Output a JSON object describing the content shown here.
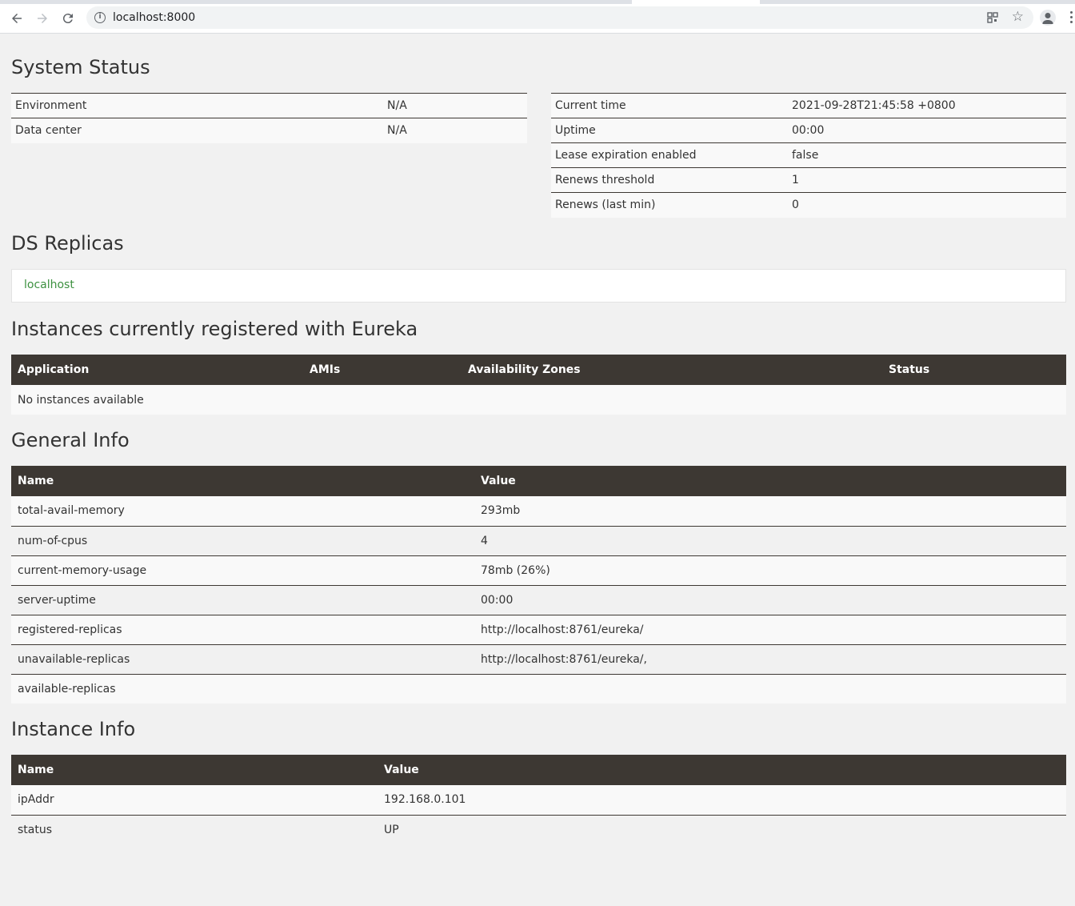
{
  "browser": {
    "url": "localhost:8000"
  },
  "system_status": {
    "title": "System Status",
    "left": [
      {
        "name": "Environment",
        "value": "N/A"
      },
      {
        "name": "Data center",
        "value": "N/A"
      }
    ],
    "right": [
      {
        "name": "Current time",
        "value": "2021-09-28T21:45:58 +0800"
      },
      {
        "name": "Uptime",
        "value": "00:00"
      },
      {
        "name": "Lease expiration enabled",
        "value": "false"
      },
      {
        "name": "Renews threshold",
        "value": "1"
      },
      {
        "name": "Renews (last min)",
        "value": "0"
      }
    ]
  },
  "ds_replicas": {
    "title": "DS Replicas",
    "items": [
      "localhost"
    ]
  },
  "instances": {
    "title": "Instances currently registered with Eureka",
    "headers": [
      "Application",
      "AMIs",
      "Availability Zones",
      "Status"
    ],
    "empty_text": "No instances available"
  },
  "general_info": {
    "title": "General Info",
    "headers": [
      "Name",
      "Value"
    ],
    "rows": [
      {
        "name": "total-avail-memory",
        "value": "293mb"
      },
      {
        "name": "num-of-cpus",
        "value": "4"
      },
      {
        "name": "current-memory-usage",
        "value": "78mb (26%)"
      },
      {
        "name": "server-uptime",
        "value": "00:00"
      },
      {
        "name": "registered-replicas",
        "value": "http://localhost:8761/eureka/"
      },
      {
        "name": "unavailable-replicas",
        "value": "http://localhost:8761/eureka/,"
      },
      {
        "name": "available-replicas",
        "value": ""
      }
    ]
  },
  "instance_info": {
    "title": "Instance Info",
    "headers": [
      "Name",
      "Value"
    ],
    "rows": [
      {
        "name": "ipAddr",
        "value": "192.168.0.101"
      },
      {
        "name": "status",
        "value": "UP"
      }
    ]
  },
  "colors": {
    "header_bg": "#3d3833",
    "link": "#3d9140",
    "page_bg": "#f1f1f1"
  }
}
